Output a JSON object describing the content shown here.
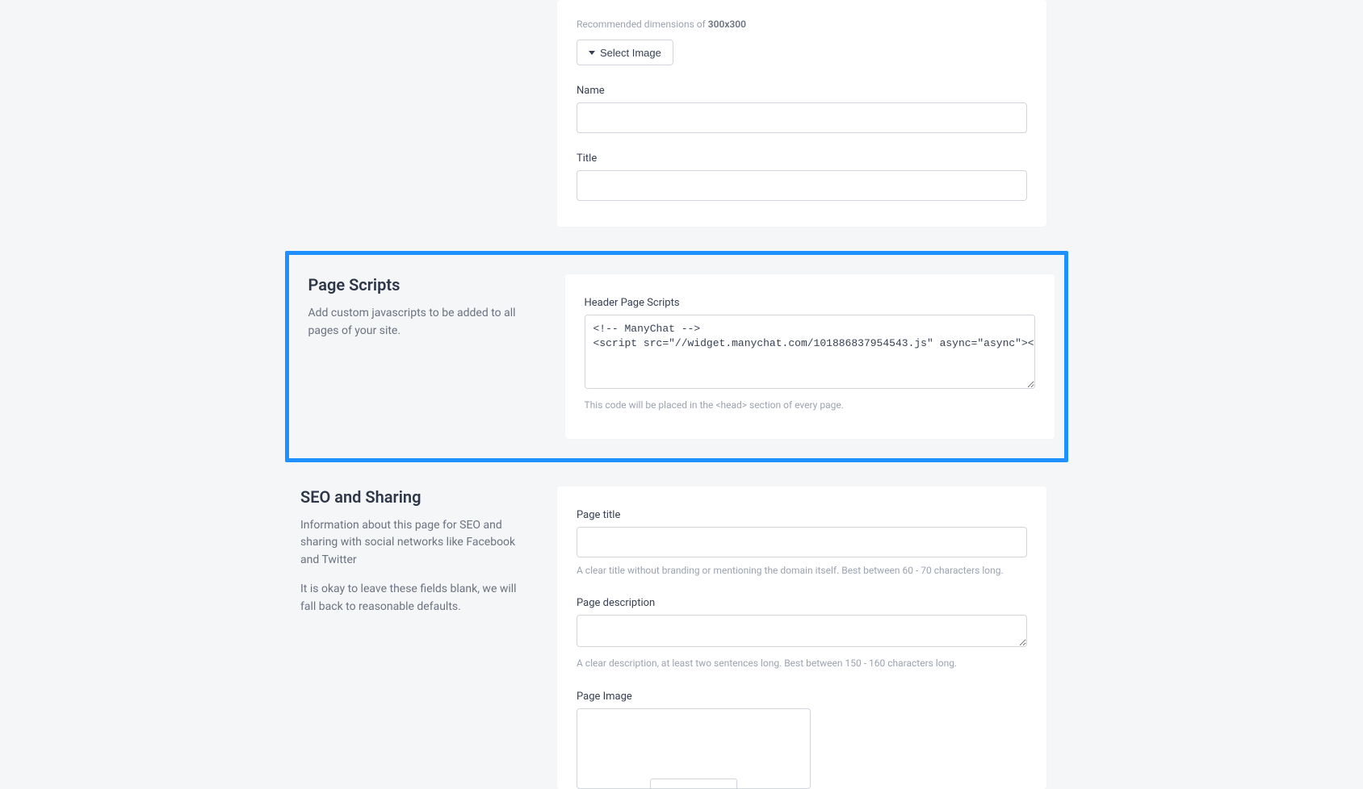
{
  "topSection": {
    "recommendedPrefix": "Recommended dimensions of ",
    "recommendedDims": "300x300",
    "selectImageLabel": "Select Image",
    "nameLabel": "Name",
    "nameValue": "",
    "titleLabel": "Title",
    "titleValue": ""
  },
  "pageScripts": {
    "heading": "Page Scripts",
    "description": "Add custom javascripts to be added to all pages of your site.",
    "headerLabel": "Header Page Scripts",
    "headerValue": "<!-- ManyChat -->\n<script src=\"//widget.manychat.com/101886837954543.js\" async=\"async\"></script>",
    "helpText": "This code will be placed in the <head> section of every page."
  },
  "seo": {
    "heading": "SEO and Sharing",
    "desc1": "Information about this page for SEO and sharing with social networks like Facebook and Twitter",
    "desc2": "It is okay to leave these fields blank, we will fall back to reasonable defaults.",
    "pageTitleLabel": "Page title",
    "pageTitleValue": "",
    "pageTitleHelp": "A clear title without branding or mentioning the domain itself. Best between 60 - 70 characters long.",
    "pageDescLabel": "Page description",
    "pageDescValue": "",
    "pageDescHelp": "A clear description, at least two sentences long. Best between 150 - 160 characters long.",
    "pageImageLabel": "Page Image"
  }
}
